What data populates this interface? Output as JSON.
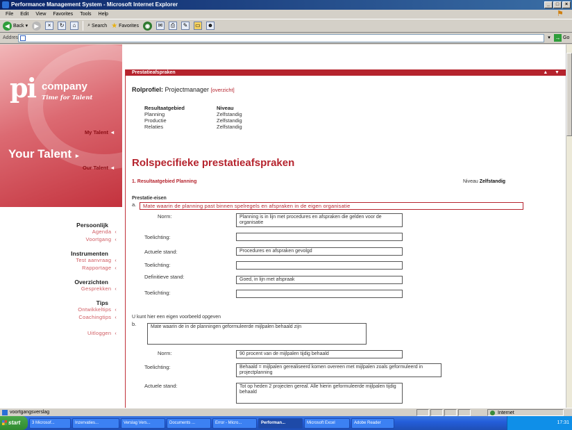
{
  "window": {
    "title": "Performance Management System - Microsoft Internet Explorer"
  },
  "menu": [
    "File",
    "Edit",
    "View",
    "Favorites",
    "Tools",
    "Help"
  ],
  "toolbar": {
    "back": "Back",
    "search": "Search",
    "favorites": "Favorites"
  },
  "address": {
    "label": "Address",
    "value": ""
  },
  "sidebar": {
    "logo": {
      "pi": "pi",
      "company": "company",
      "tagline": "Time for Talent"
    },
    "my_talent": "My Talent",
    "your_talent": "Your Talent",
    "our_talent": "Our Talent",
    "sections": [
      {
        "heading": "Persoonlijk",
        "links": [
          "Agenda",
          "Voortgang"
        ]
      },
      {
        "heading": "Instrumenten",
        "links": [
          "Test aanvraag",
          "Rapportage"
        ]
      },
      {
        "heading": "Overzichten",
        "links": [
          "Gesprekken"
        ]
      },
      {
        "heading": "Tips",
        "links": [
          "Ontwikkeltips",
          "Coachingtips"
        ]
      }
    ],
    "logout": "Uitloggen"
  },
  "main": {
    "header": "Prestatieafspraken",
    "rolprofiel_label": "Rolprofiel:",
    "rolprofiel_value": "Projectmanager",
    "rolprofiel_link": "[overzicht]",
    "table": {
      "headers": [
        "Resultaatgebied",
        "Niveau"
      ],
      "rows": [
        [
          "Planning",
          "Zelfstandig"
        ],
        [
          "Productie",
          "Zelfstandig"
        ],
        [
          "Relaties",
          "Zelfstandig"
        ]
      ]
    },
    "title": "Rolspecifieke prestatieafspraken",
    "section": "1. Resultaatgebied Planning",
    "niveau_label": "Niveau",
    "niveau_value": "Zelfstandig",
    "prestatie_label": "Prestatie-eisen",
    "item_a": {
      "index": "a.",
      "eis": "Mate waarin de planning past binnen spelregels en afspraken in de eigen organisatie",
      "norm_label": "Norm:",
      "norm_value": "Planning is in lijn met procedures en afspraken die gelden voor de organisatie",
      "toelichting_label": "Toelichting:",
      "actuele_label": "Actuele stand:",
      "actuele_value": "Procedures en afspraken gevolgd",
      "toelichting2_label": "Toelichting:",
      "definitieve_label": "Definitieve stand:",
      "definitieve_value": "Goed, in lijn met afspraak",
      "toelichting3_label": "Toelichting:"
    },
    "eigen_label": "U kunt hier een eigen voorbeeld opgeven",
    "item_b": {
      "index": "b.",
      "eis": "Mate waarin de in de planningen geformuleerde mijlpalen behaald zijn",
      "norm_label": "Norm:",
      "norm_value": "90 procent van de mijlpalen tijdig behaald",
      "toelichting_label": "Toelichting:",
      "toelichting_value": "Behaald = mijlpalen gerealiseerd komen overeen met mijlpalen zoals geformuleerd in projectplanning",
      "actuele_label": "Actuele stand:",
      "actuele_value": "Tot op heden 2 projecten gereal. Alle hierin geformuleerde mijlpalen tijdig behaald"
    }
  },
  "status": {
    "text": "voortgangsverslag",
    "zone": "Internet"
  },
  "taskbar": {
    "start": "start",
    "tasks": [
      "3 Microsof...",
      "Inzervaties...",
      "Verslag Vers...",
      "Documents ...",
      "Error - Micro...",
      "Performan...",
      "Microsoft Excel",
      "Adobe Reader"
    ],
    "active_index": 5,
    "clock": "17:31"
  }
}
